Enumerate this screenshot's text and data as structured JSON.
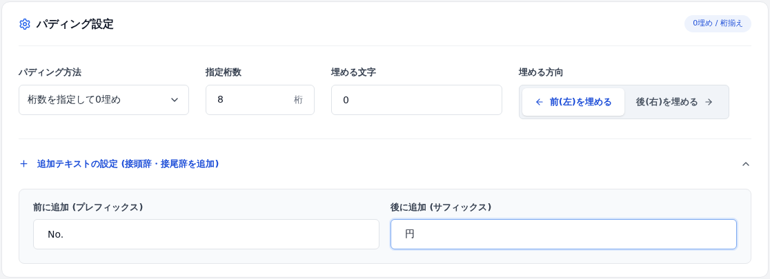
{
  "title": "パディング設定",
  "badge": "0埋め / 桁揃え",
  "padding_method": {
    "label": "パディング方法",
    "value": "桁数を指定して0埋め"
  },
  "digits": {
    "label": "指定桁数",
    "value": "8",
    "unit": "桁"
  },
  "fill_char": {
    "label": "埋める文字",
    "value": "0"
  },
  "direction": {
    "label": "埋める方向",
    "options": [
      {
        "label": "前(左)を埋める",
        "kind": "left",
        "selected": true
      },
      {
        "label": "後(右)を埋める",
        "kind": "right",
        "selected": false
      }
    ]
  },
  "additional": {
    "label": "追加テキストの設定 (接頭辞・接尾辞を追加)",
    "expanded": true,
    "prefix": {
      "label": "前に追加 (プレフィックス)",
      "value": "No.",
      "focused": false
    },
    "suffix": {
      "label": "後に追加 (サフィックス)",
      "value": "円",
      "focused": true
    }
  }
}
